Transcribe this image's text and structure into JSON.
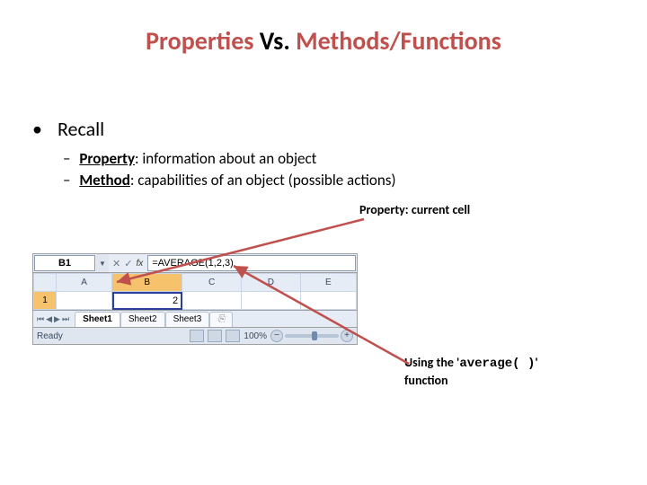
{
  "title": {
    "properties": "Properties",
    "vs": " Vs. ",
    "methods": "Methods/Functions"
  },
  "bullets": {
    "recall": "Recall",
    "property_label": "Property",
    "property_text": ": information about an object",
    "method_label": "Method",
    "method_text": ": capabilities of an object (possible actions)"
  },
  "callouts": {
    "cell": "Property: current cell",
    "avg_pre": "Using the '",
    "avg_fn": "average( )",
    "avg_post": "' function"
  },
  "excel": {
    "name_box": "B1",
    "formula": "=AVERAGE(1,2,3)",
    "columns": [
      "A",
      "B",
      "C",
      "D",
      "E"
    ],
    "row1": "1",
    "b1_value": "2",
    "sheets": {
      "s1": "Sheet1",
      "s2": "Sheet2",
      "s3": "Sheet3",
      "ins": "⎘"
    },
    "ready": "Ready",
    "zoom": "100%"
  }
}
